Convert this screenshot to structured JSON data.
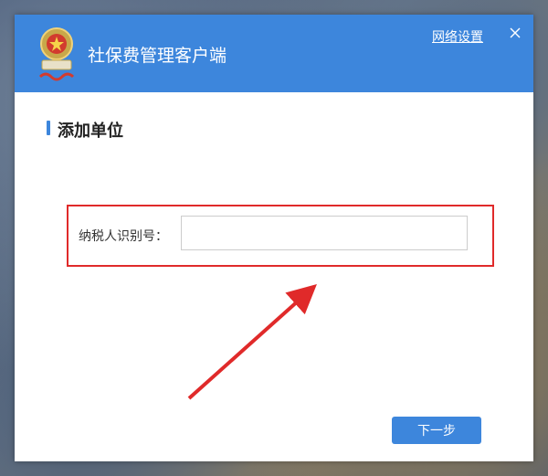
{
  "window": {
    "app_title": "社保费管理客户端",
    "network_settings_label": "网络设置",
    "close_icon": "×"
  },
  "content": {
    "section_title": "添加单位",
    "taxpayer_id_label": "纳税人识别号：",
    "taxpayer_id_value": "",
    "taxpayer_id_placeholder": ""
  },
  "footer": {
    "next_button_label": "下一步"
  },
  "colors": {
    "titlebar": "#3d86dc",
    "accent": "#3d86dc",
    "highlight": "#e02a2a"
  },
  "icons": {
    "logo": "tax-emblem-icon",
    "close": "close-icon",
    "annotation": "red-arrow-icon"
  }
}
